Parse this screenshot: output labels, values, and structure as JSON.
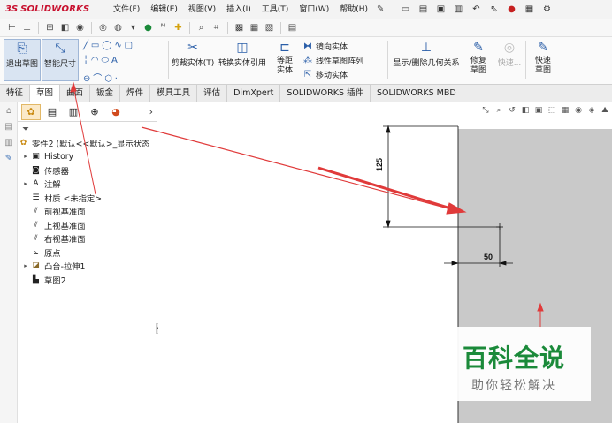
{
  "app": {
    "logo_ds": "3S",
    "logo_text": "SOLIDWORKS"
  },
  "menu": [
    "文件(F)",
    "编辑(E)",
    "视图(V)",
    "插入(I)",
    "工具(T)",
    "窗口(W)",
    "帮助(H)"
  ],
  "ribbon": {
    "exit_sketch": "退出草图",
    "smart_dimension": "智能尺寸",
    "trim": "剪裁实体(T)",
    "convert": "转换实体引用",
    "offset": "等距实体",
    "mirror": "镜向实体",
    "linear_pattern": "线性草图阵列",
    "move": "移动实体",
    "relations": "显示/删除几何关系",
    "repair": "修复草图",
    "quick_snaps": "快速...",
    "rapid_sketch": "快速草图"
  },
  "tabs": [
    "特征",
    "草图",
    "曲面",
    "钣金",
    "焊件",
    "模具工具",
    "评估",
    "DimXpert",
    "SOLIDWORKS 插件",
    "SOLIDWORKS MBD"
  ],
  "active_tab": "草图",
  "tree": {
    "root": "零件2 (默认<<默认>_显示状态",
    "items": [
      {
        "label": "History",
        "expand": true,
        "icon": "history-icon"
      },
      {
        "label": "传感器",
        "expand": false,
        "icon": "sensor-icon"
      },
      {
        "label": "注解",
        "expand": true,
        "icon": "annotation-icon"
      },
      {
        "label": "材质 <未指定>",
        "expand": false,
        "icon": "material-icon"
      },
      {
        "label": "前视基准面",
        "expand": false,
        "icon": "plane-icon"
      },
      {
        "label": "上视基准面",
        "expand": false,
        "icon": "plane-icon"
      },
      {
        "label": "右视基准面",
        "expand": false,
        "icon": "plane-icon"
      },
      {
        "label": "原点",
        "expand": false,
        "icon": "origin-icon"
      },
      {
        "label": "凸台-拉伸1",
        "expand": true,
        "icon": "extrude-icon"
      },
      {
        "label": "草图2",
        "expand": false,
        "icon": "sketch-icon"
      }
    ]
  },
  "dimensions": {
    "vertical": "125",
    "horizontal": "50"
  },
  "watermark": {
    "title": "百科全说",
    "subtitle": "助你轻松解决"
  },
  "colors": {
    "arrow": "#e03a3a",
    "logo": "#c8102e",
    "watermark": "#1b8a3a",
    "face": "#c9c9c9"
  }
}
